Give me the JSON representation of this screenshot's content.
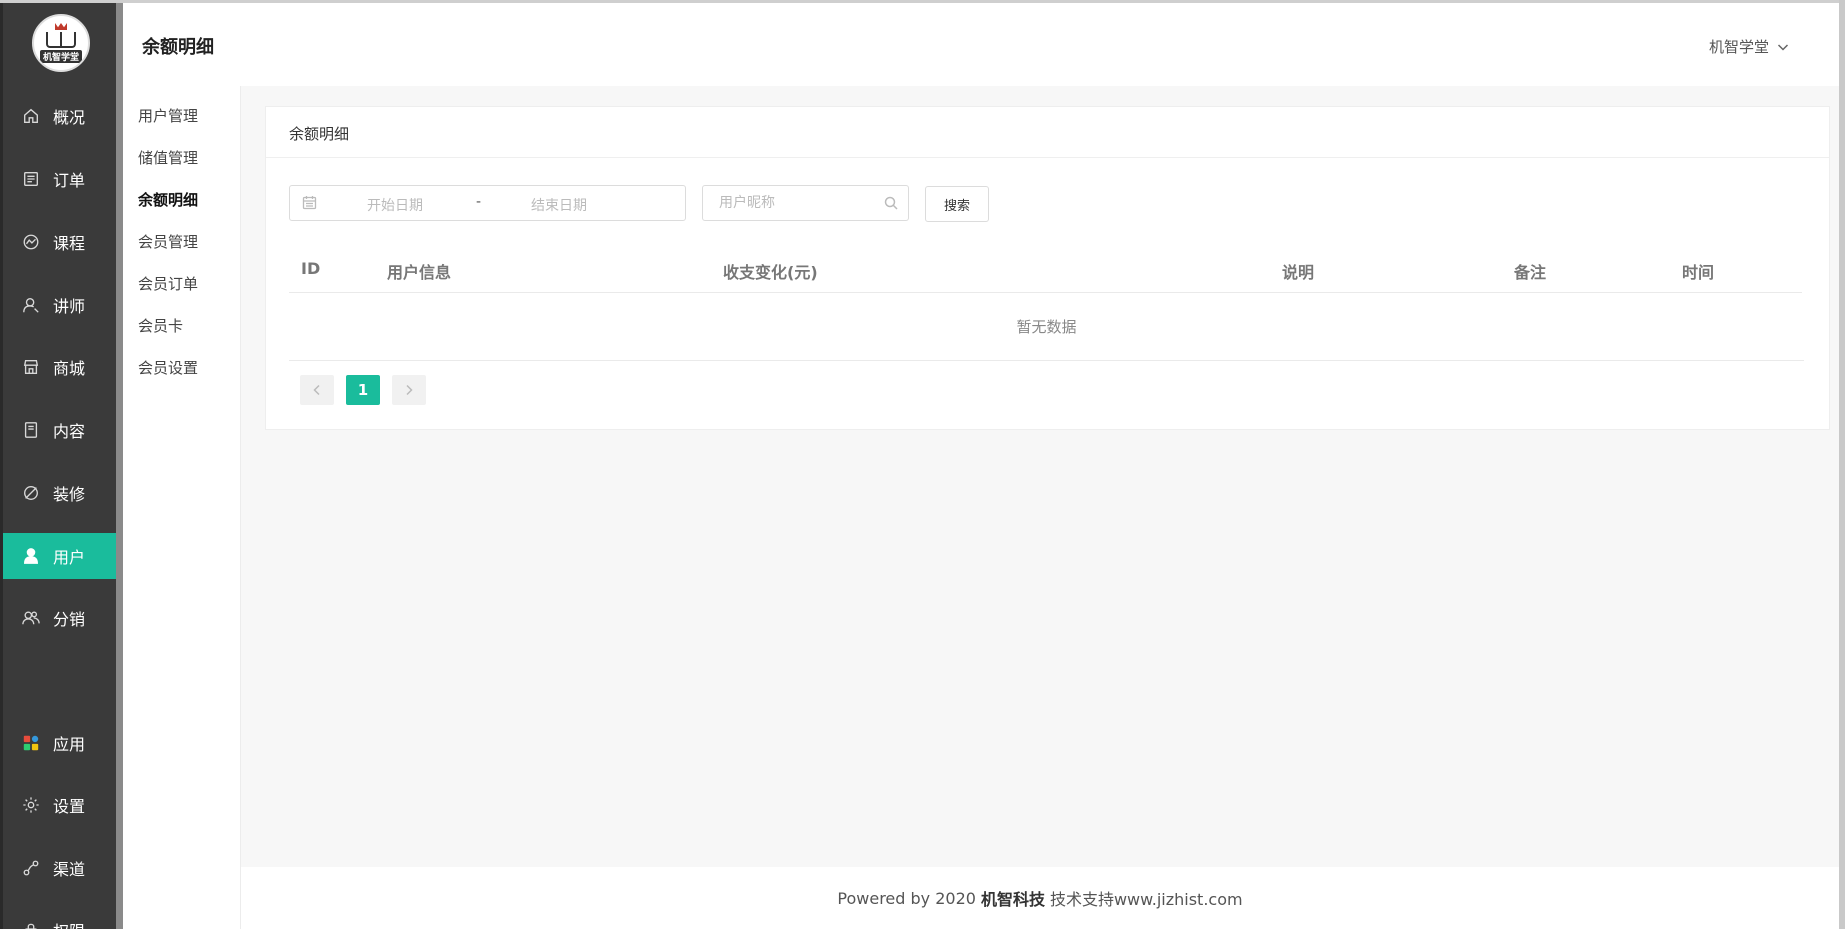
{
  "app": {
    "logo_text": "机智学堂",
    "accent_color": "#1abc9c",
    "sidebar_color": "#3a3a3a"
  },
  "sidebar": {
    "items": [
      {
        "label": "概况",
        "icon": "home-icon"
      },
      {
        "label": "订单",
        "icon": "order-list-icon"
      },
      {
        "label": "课程",
        "icon": "course-chart-icon"
      },
      {
        "label": "讲师",
        "icon": "teacher-icon"
      },
      {
        "label": "商城",
        "icon": "store-icon"
      },
      {
        "label": "内容",
        "icon": "content-doc-icon"
      },
      {
        "label": "装修",
        "icon": "decorate-brush-icon"
      },
      {
        "label": "用户",
        "icon": "user-icon",
        "active": true
      },
      {
        "label": "分销",
        "icon": "distribution-users-icon"
      },
      {
        "label": "应用",
        "icon": "apps-grid-icon"
      },
      {
        "label": "设置",
        "icon": "gear-icon"
      },
      {
        "label": "渠道",
        "icon": "channel-link-icon"
      },
      {
        "label": "权限",
        "icon": "permission-icon"
      }
    ]
  },
  "header": {
    "title": "余额明细",
    "user_name": "机智学堂"
  },
  "subnav": {
    "items": [
      {
        "label": "用户管理"
      },
      {
        "label": "储值管理"
      },
      {
        "label": "余额明细",
        "active": true
      },
      {
        "label": "会员管理"
      },
      {
        "label": "会员订单"
      },
      {
        "label": "会员卡"
      },
      {
        "label": "会员设置"
      }
    ]
  },
  "card": {
    "title": "余额明细",
    "filters": {
      "start_placeholder": "开始日期",
      "separator": "-",
      "end_placeholder": "结束日期",
      "nickname_placeholder": "用户昵称",
      "search_label": "搜索"
    },
    "table": {
      "columns": [
        "ID",
        "用户信息",
        "收支变化(元)",
        "说明",
        "备注",
        "时间"
      ],
      "rows": [],
      "empty_text": "暂无数据"
    },
    "pagination": {
      "current_page": "1"
    }
  },
  "footer": {
    "prefix": "Powered by 2020",
    "company": "机智科技",
    "suffix": "技术支持www.jizhist.com"
  }
}
